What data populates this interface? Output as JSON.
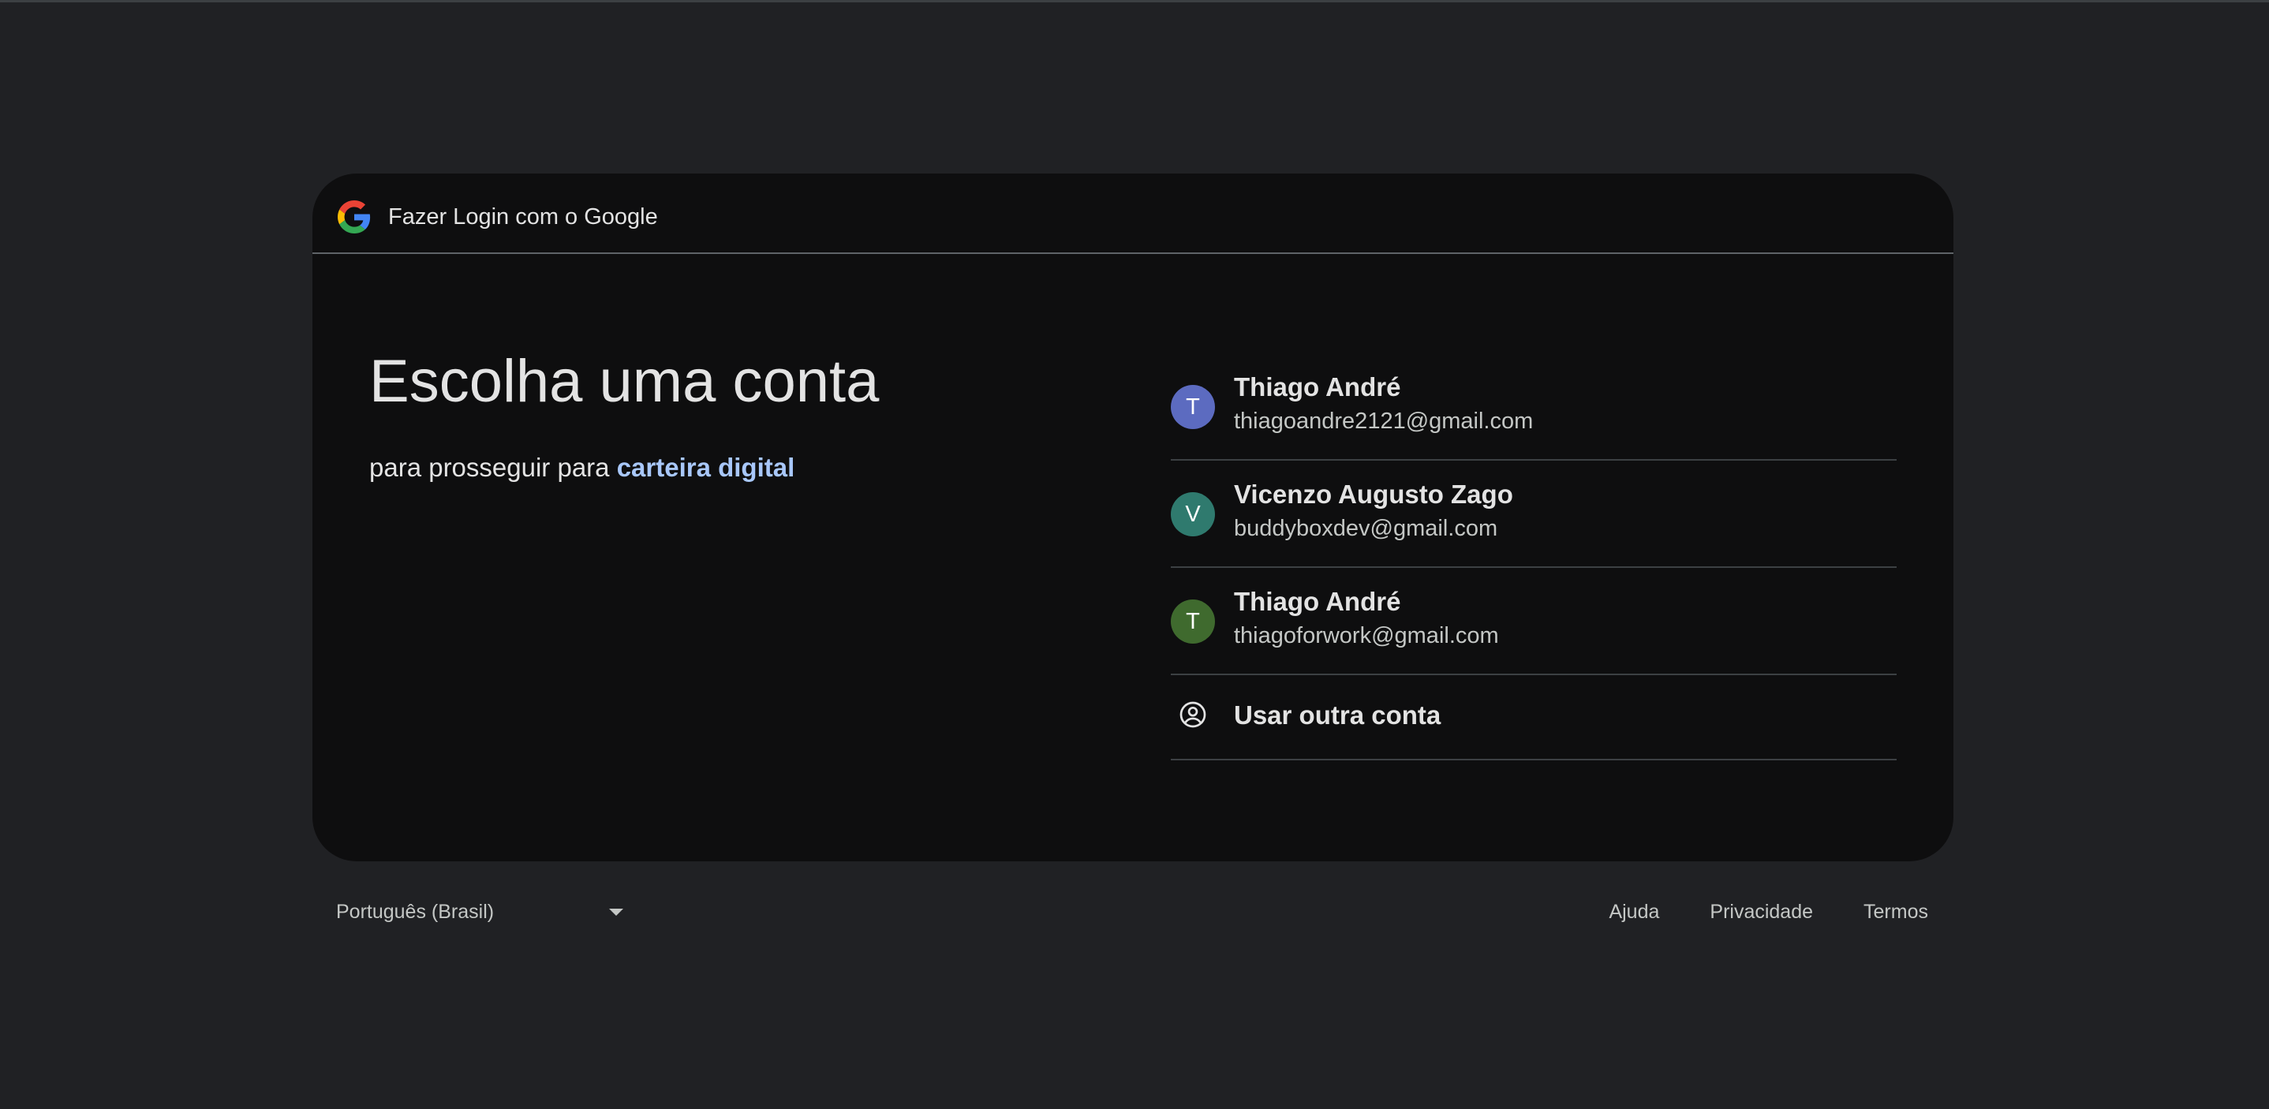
{
  "header": {
    "title": "Fazer Login com o Google",
    "logo_icon": "google-g-icon"
  },
  "main": {
    "title": "Escolha uma conta",
    "subtitle_prefix": "para prosseguir para ",
    "app_name": "carteira digital"
  },
  "accounts": [
    {
      "initial": "T",
      "name": "Thiago André",
      "email": "thiagoandre2121@gmail.com",
      "avatar_color": "#5c6bc0"
    },
    {
      "initial": "V",
      "name": "Vicenzo Augusto Zago",
      "email": "buddyboxdev@gmail.com",
      "avatar_color": "#2f7a6e"
    },
    {
      "initial": "T",
      "name": "Thiago André",
      "email": "thiagoforwork@gmail.com",
      "avatar_color": "#3f6a2e"
    }
  ],
  "other_account": {
    "label": "Usar outra conta",
    "icon": "account-circle-icon"
  },
  "footer": {
    "language": "Português (Brasil)",
    "links": [
      "Ajuda",
      "Privacidade",
      "Termos"
    ]
  },
  "colors": {
    "background": "#202124",
    "card": "#0e0e0f",
    "link": "#a8c7fa"
  }
}
